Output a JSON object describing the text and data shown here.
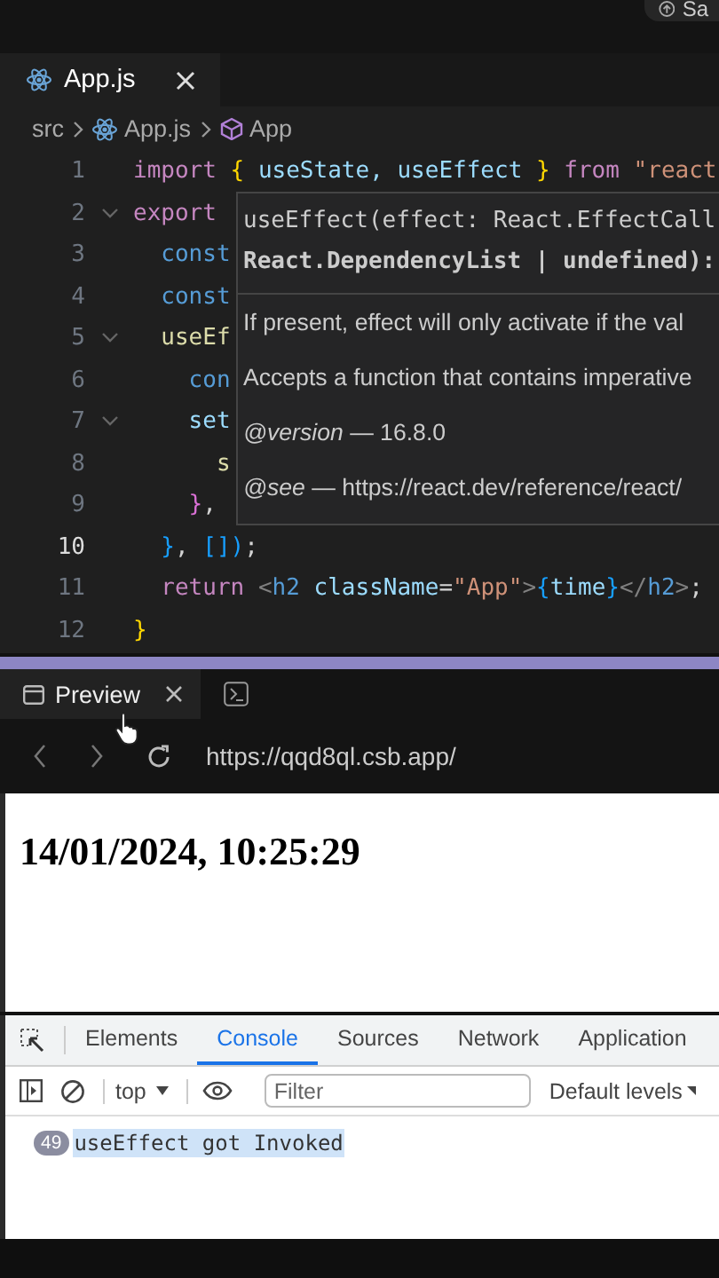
{
  "top_bar": {
    "button": "Sa"
  },
  "editor": {
    "tabs": [
      {
        "label": "App.js",
        "selected": true
      }
    ],
    "breadcrumb": [
      "src",
      "App.js",
      "App"
    ],
    "lines": [
      {
        "number": "1",
        "current": false,
        "foldable": false,
        "tokens": [
          {
            "text": "import",
            "kind": "keyword"
          },
          {
            "text": " {",
            "kind": "brace"
          },
          {
            "text": " useState, useEffect",
            "kind": "variable"
          },
          {
            "text": " }",
            "kind": "brace"
          },
          {
            "text": " from",
            "kind": "keyword"
          },
          {
            "text": " \"react",
            "kind": "string"
          }
        ]
      },
      {
        "number": "2",
        "current": false,
        "foldable": true,
        "tokens": [
          {
            "text": "export",
            "kind": "keyword"
          }
        ]
      },
      {
        "number": "3",
        "current": false,
        "foldable": false,
        "tokens": [
          {
            "text": "  const",
            "kind": "storage"
          }
        ]
      },
      {
        "number": "4",
        "current": false,
        "foldable": false,
        "tokens": [
          {
            "text": "  const",
            "kind": "storage"
          }
        ]
      },
      {
        "number": "5",
        "current": false,
        "foldable": true,
        "tokens": [
          {
            "text": "  useEf",
            "kind": "function"
          }
        ]
      },
      {
        "number": "6",
        "current": false,
        "foldable": false,
        "tokens": [
          {
            "text": "    con",
            "kind": "storage"
          }
        ]
      },
      {
        "number": "7",
        "current": false,
        "foldable": true,
        "tokens": [
          {
            "text": "    set",
            "kind": "variable"
          }
        ]
      },
      {
        "number": "8",
        "current": false,
        "foldable": false,
        "tokens": [
          {
            "text": "      s",
            "kind": "function"
          }
        ]
      },
      {
        "number": "9",
        "current": false,
        "foldable": false,
        "tokens": [
          {
            "text": "    }",
            "kind": "brace2"
          },
          {
            "text": ",",
            "kind": "plain"
          }
        ]
      },
      {
        "number": "10",
        "current": true,
        "foldable": false,
        "tokens": [
          {
            "text": "  }",
            "kind": "brace3"
          },
          {
            "text": ", ",
            "kind": "plain"
          },
          {
            "text": "[])",
            "kind": "brace3"
          },
          {
            "text": ";",
            "kind": "plain"
          }
        ]
      },
      {
        "number": "11",
        "current": false,
        "foldable": false,
        "tokens": [
          {
            "text": "  return",
            "kind": "keyword"
          },
          {
            "text": " <",
            "kind": "punct"
          },
          {
            "text": "h2",
            "kind": "tag"
          },
          {
            "text": " className",
            "kind": "attr"
          },
          {
            "text": "=",
            "kind": "plain"
          },
          {
            "text": "\"App\"",
            "kind": "string"
          },
          {
            "text": ">",
            "kind": "punct"
          },
          {
            "text": "{",
            "kind": "brace3"
          },
          {
            "text": "time",
            "kind": "variable"
          },
          {
            "text": "}",
            "kind": "brace3"
          },
          {
            "text": "</",
            "kind": "punct"
          },
          {
            "text": "h2",
            "kind": "tag"
          },
          {
            "text": ">",
            "kind": "punct"
          },
          {
            "text": ";",
            "kind": "plain"
          }
        ]
      },
      {
        "number": "12",
        "current": false,
        "foldable": false,
        "tokens": [
          {
            "text": "}",
            "kind": "brace"
          }
        ]
      }
    ],
    "hover": {
      "signature": [
        "useEffect(effect: React.EffectCall",
        "React.DependencyList | undefined):"
      ],
      "docs": [
        "If present, effect will only activate if the val",
        "Accepts a function that contains imperative"
      ],
      "tags": [
        {
          "tag": "@version",
          "text": "— 16.8.0"
        },
        {
          "tag": "@see",
          "text": "— https://react.dev/reference/react/"
        }
      ]
    }
  },
  "preview": {
    "tabs": [
      {
        "kind": "preview",
        "label": "Preview",
        "selected": true
      },
      {
        "kind": "terminal",
        "selected": false
      }
    ],
    "url": "https://qqd8ql.csb.app/",
    "heading": "14/01/2024, 10:25:29"
  },
  "devtools": {
    "tabs": [
      {
        "label": "Elements",
        "selected": false
      },
      {
        "label": "Console",
        "selected": true
      },
      {
        "label": "Sources",
        "selected": false
      },
      {
        "label": "Network",
        "selected": false
      },
      {
        "label": "Application",
        "selected": false
      }
    ],
    "context": "top",
    "filter_placeholder": "Filter",
    "levels": "Default levels",
    "messages": [
      {
        "count": "49",
        "text": "useEffect got Invoked",
        "highlighted": true
      }
    ]
  }
}
